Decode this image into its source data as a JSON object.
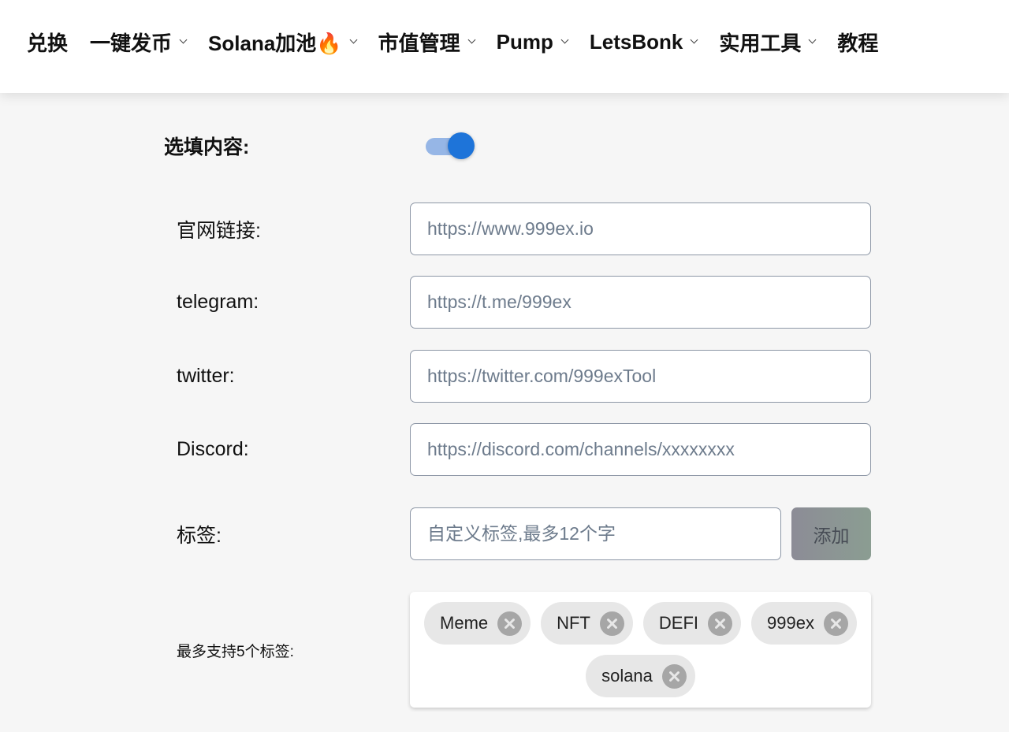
{
  "nav": {
    "items": [
      {
        "label": "兑换",
        "has_dropdown": false
      },
      {
        "label": "一键发币",
        "has_dropdown": true
      },
      {
        "label": "Solana加池🔥",
        "has_dropdown": true
      },
      {
        "label": "市值管理",
        "has_dropdown": true
      },
      {
        "label": "Pump",
        "has_dropdown": true
      },
      {
        "label": "LetsBonk",
        "has_dropdown": true
      },
      {
        "label": "实用工具",
        "has_dropdown": true
      },
      {
        "label": "教程",
        "has_dropdown": false
      }
    ]
  },
  "optional": {
    "label": "选填内容:",
    "toggle_on": true
  },
  "fields": {
    "website": {
      "label": "官网链接:",
      "value": "",
      "placeholder": "https://www.999ex.io"
    },
    "telegram": {
      "label": "telegram:",
      "value": "",
      "placeholder": "https://t.me/999ex"
    },
    "twitter": {
      "label": "twitter:",
      "value": "",
      "placeholder": "https://twitter.com/999exTool"
    },
    "discord": {
      "label": "Discord:",
      "value": "",
      "placeholder": "https://discord.com/channels/xxxxxxxx"
    }
  },
  "tags": {
    "label": "标签:",
    "input_value": "",
    "placeholder": "自定义标签,最多12个字",
    "add_label": "添加",
    "limit_label": "最多支持5个标签:",
    "items": [
      {
        "label": "Meme"
      },
      {
        "label": "NFT"
      },
      {
        "label": "DEFI"
      },
      {
        "label": "999ex"
      },
      {
        "label": "solana"
      }
    ]
  },
  "colors": {
    "toggle_track": "#96b6e6",
    "toggle_knob": "#1e74d9",
    "chip_bg": "#e7e7e7",
    "chip_remove": "#a6a6a6"
  },
  "icons": [
    "chevron-down-icon",
    "remove-tag-icon"
  ]
}
